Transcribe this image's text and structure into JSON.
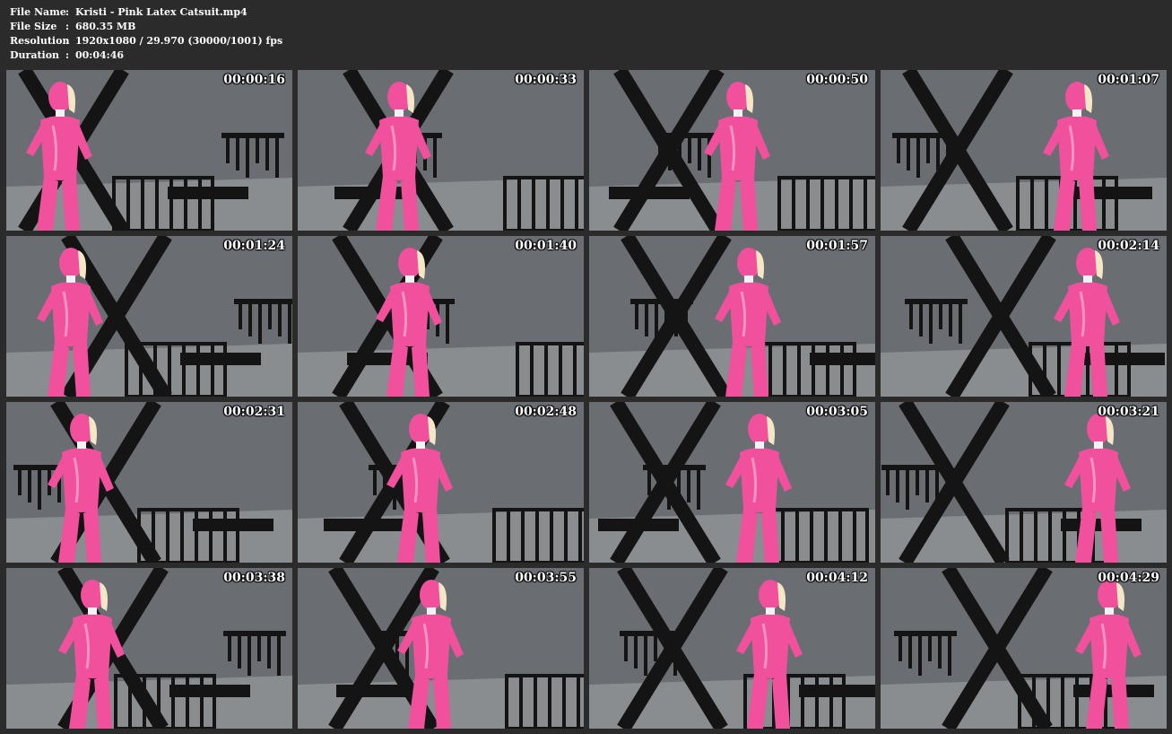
{
  "file_info": {
    "rows": [
      {
        "label": "File Name",
        "separator": ":",
        "value": "Kristi - Pink Latex Catsuit.mp4"
      },
      {
        "label": "File Size",
        "separator": ":",
        "value": "680.35 MB"
      },
      {
        "label": "Resolution",
        "separator": ":",
        "value": "1920x1080 / 29.970 (30000/1001) fps"
      },
      {
        "label": "Duration",
        "separator": ":",
        "value": "00:04:46"
      }
    ]
  },
  "thumbnails": [
    {
      "timestamp": "00:00:16"
    },
    {
      "timestamp": "00:00:33"
    },
    {
      "timestamp": "00:00:50"
    },
    {
      "timestamp": "00:01:07"
    },
    {
      "timestamp": "00:01:24"
    },
    {
      "timestamp": "00:01:40"
    },
    {
      "timestamp": "00:01:57"
    },
    {
      "timestamp": "00:02:14"
    },
    {
      "timestamp": "00:02:31"
    },
    {
      "timestamp": "00:02:48"
    },
    {
      "timestamp": "00:03:05"
    },
    {
      "timestamp": "00:03:21"
    },
    {
      "timestamp": "00:03:38"
    },
    {
      "timestamp": "00:03:55"
    },
    {
      "timestamp": "00:04:12"
    },
    {
      "timestamp": "00:04:29"
    }
  ],
  "colors": {
    "background": "#2b2b2b",
    "text": "#ffffff",
    "catsuit_pink": "#f0509c",
    "wall_gray": "#6a6d72",
    "floor_gray": "#8a8d90",
    "furniture_black": "#141414"
  }
}
